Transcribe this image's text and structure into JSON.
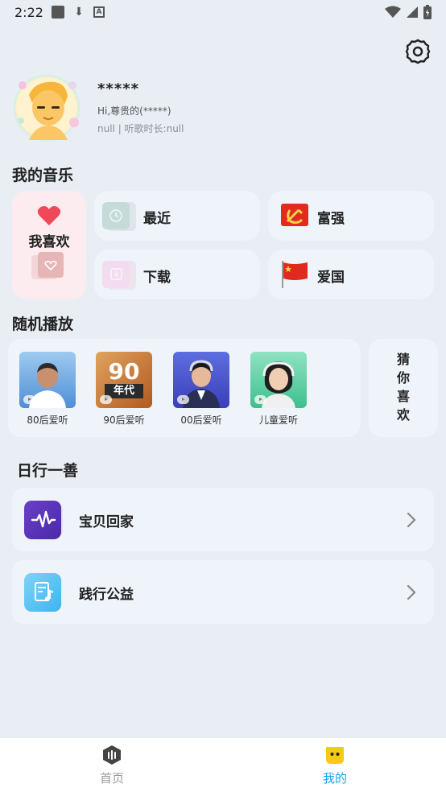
{
  "status_bar": {
    "time": "2:22"
  },
  "profile": {
    "username": "*****",
    "greeting": "Hi,尊贵的(*****)",
    "listen_time": "null | 听歌时长:null"
  },
  "my_music": {
    "title": "我的音乐",
    "favorite": "我喜欢",
    "recent": "最近",
    "download": "下载",
    "prosperity": "富强",
    "patriotism": "爱国"
  },
  "random_play": {
    "title": "随机播放",
    "items": [
      {
        "label": "80后爱听"
      },
      {
        "label": "90后爱听",
        "cover_text": "90",
        "cover_sub": "年代"
      },
      {
        "label": "00后爱听"
      },
      {
        "label": "儿童爱听"
      }
    ],
    "guess": "猜你喜欢"
  },
  "daily_good": {
    "title": "日行一善",
    "items": [
      {
        "label": "宝贝回家"
      },
      {
        "label": "践行公益"
      }
    ]
  },
  "bottom_nav": {
    "home": "首页",
    "mine": "我的",
    "active_color": "#1aa3e8",
    "inactive_color": "#999999"
  }
}
